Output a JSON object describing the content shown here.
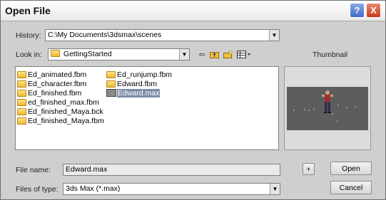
{
  "window": {
    "title": "Open File"
  },
  "history": {
    "label": "History:",
    "value": "C:\\My Documents\\3dsmax\\scenes"
  },
  "look_in": {
    "label": "Look in:",
    "value": "GettingStarted"
  },
  "thumbnail_label": "Thumbnail",
  "files": [
    {
      "name": "Ed_animated.fbm",
      "type": "folder"
    },
    {
      "name": "Ed_character.fbm",
      "type": "folder"
    },
    {
      "name": "Ed_finished.fbm",
      "type": "folder"
    },
    {
      "name": "ed_finished_max.fbm",
      "type": "folder"
    },
    {
      "name": "Ed_finished_Maya.bck",
      "type": "folder"
    },
    {
      "name": "Ed_finished_Maya.fbm",
      "type": "folder"
    },
    {
      "name": "Ed_runjump.fbm",
      "type": "folder"
    },
    {
      "name": "Edward.fbm",
      "type": "folder"
    },
    {
      "name": "Edward.max",
      "type": "max",
      "selected": true
    }
  ],
  "file_name": {
    "label": "File name:",
    "value": "Edward.max"
  },
  "files_of_type": {
    "label": "Files of type:",
    "value": "3ds Max (*.max)"
  },
  "buttons": {
    "plus": "+",
    "open": "Open",
    "cancel": "Cancel"
  },
  "icons": {
    "help": "?",
    "close": "X",
    "dropdown": "▼",
    "back": "⇦",
    "up_folder": "folder-up-icon",
    "new_folder": "new-folder-icon",
    "view_menu": "view-menu-icon"
  }
}
